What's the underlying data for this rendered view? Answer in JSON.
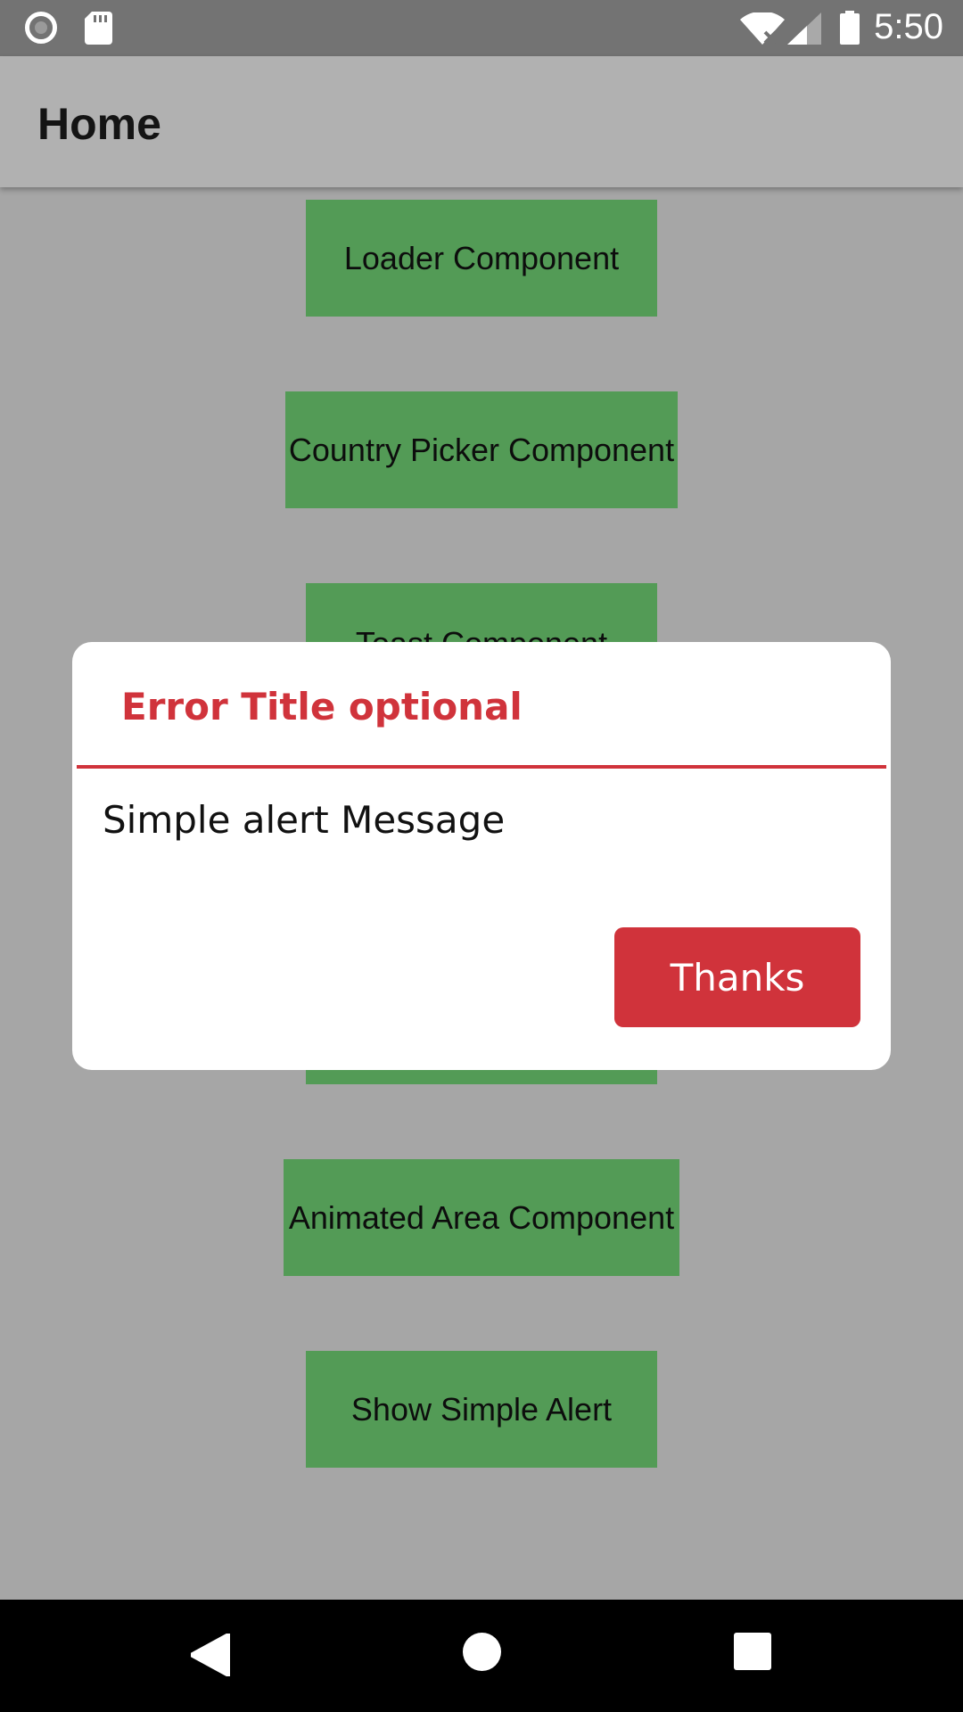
{
  "status_bar": {
    "time": "5:50",
    "icons": [
      "record-icon",
      "sd-card-icon",
      "wifi-off-icon",
      "signal-icon",
      "battery-icon"
    ]
  },
  "app_bar": {
    "title": "Home"
  },
  "components": [
    {
      "label": "Loader Component"
    },
    {
      "label": "Country Picker Component"
    },
    {
      "label": "Toast Component"
    },
    {
      "label": "Animated Area Component"
    },
    {
      "label": "Show Simple Alert"
    }
  ],
  "dialog": {
    "title": "Error Title optional",
    "message": "Simple alert Message",
    "button_label": "Thanks"
  },
  "nav_bar": {
    "icons": [
      "back-icon",
      "home-icon",
      "recents-icon"
    ]
  },
  "colors": {
    "background_dim": "#a6a6a6",
    "app_bar": "#b1b1b1",
    "button_green": "#539b56",
    "accent_red": "#d0333b",
    "dialog_bg": "#ffffff"
  }
}
